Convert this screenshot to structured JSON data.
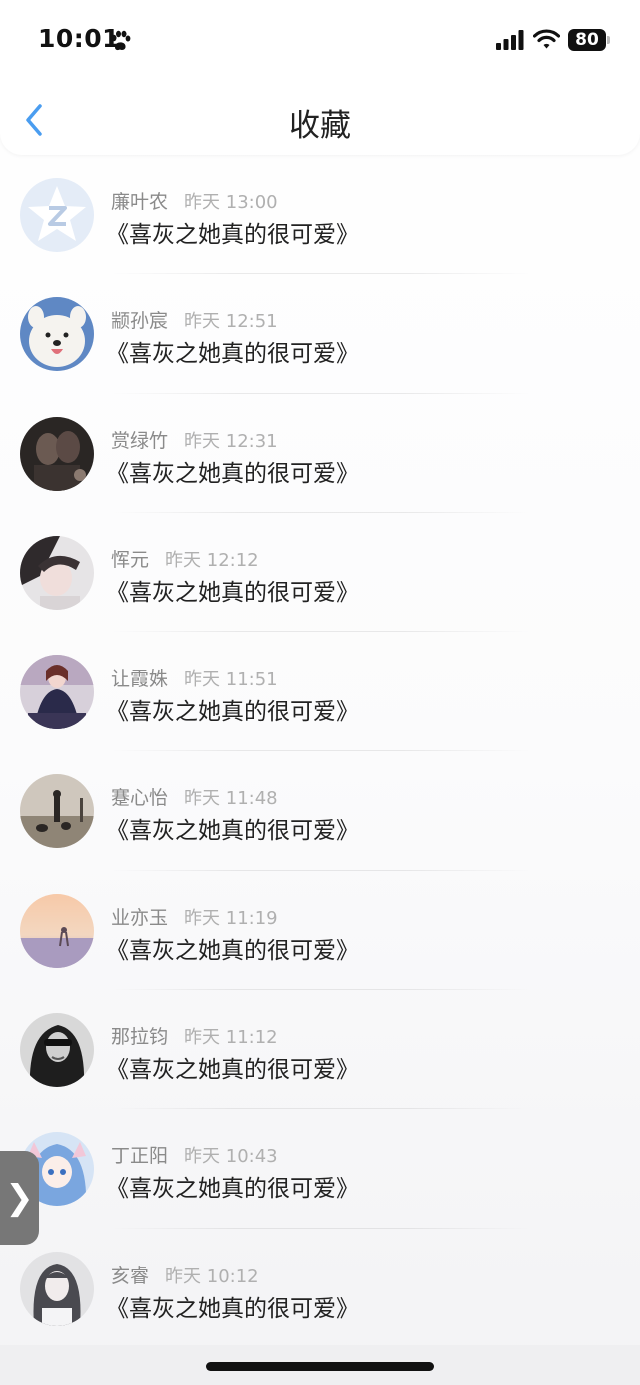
{
  "status_bar": {
    "time": "10:01",
    "battery": "80"
  },
  "nav": {
    "title": "收藏"
  },
  "items": [
    {
      "name": "廉叶农",
      "time": "昨天 13:00",
      "message": "《喜灰之她真的很可爱》"
    },
    {
      "name": "颛孙宸",
      "time": "昨天 12:51",
      "message": "《喜灰之她真的很可爱》"
    },
    {
      "name": "赏绿竹",
      "time": "昨天 12:31",
      "message": "《喜灰之她真的很可爱》"
    },
    {
      "name": "恽元",
      "time": "昨天 12:12",
      "message": "《喜灰之她真的很可爱》"
    },
    {
      "name": "让霞姝",
      "time": "昨天 11:51",
      "message": "《喜灰之她真的很可爱》"
    },
    {
      "name": "蹇心怡",
      "time": "昨天 11:48",
      "message": "《喜灰之她真的很可爱》"
    },
    {
      "name": "业亦玉",
      "time": "昨天 11:19",
      "message": "《喜灰之她真的很可爱》"
    },
    {
      "name": "那拉钧",
      "time": "昨天 11:12",
      "message": "《喜灰之她真的很可爱》"
    },
    {
      "name": "丁正阳",
      "time": "昨天 10:43",
      "message": "《喜灰之她真的很可爱》"
    },
    {
      "name": "亥睿",
      "time": "昨天 10:12",
      "message": "《喜灰之她真的很可爱》"
    }
  ],
  "side_handle": {
    "label": "❯"
  },
  "colors": {
    "accent": "#4a9df0",
    "name_gray": "#8a8a8a",
    "time_gray": "#b0b0b0"
  }
}
